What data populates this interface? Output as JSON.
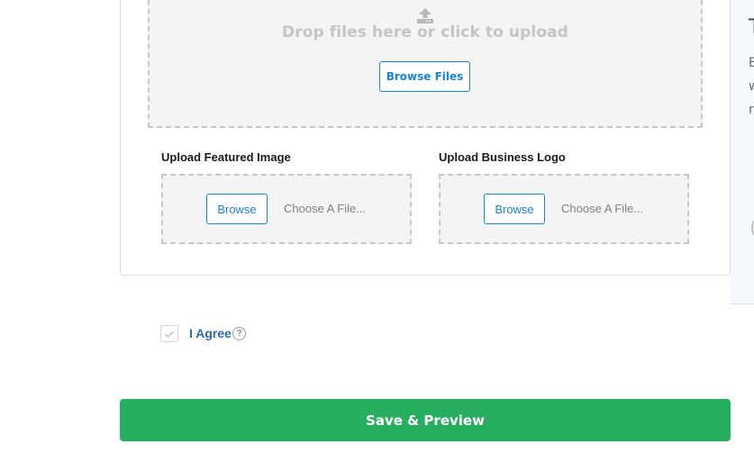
{
  "dropzone": {
    "icon": "upload-icon",
    "text": "Drop files here or click to upload",
    "browse_label": "Browse Files"
  },
  "uploads": [
    {
      "label": "Upload Featured Image",
      "browse_label": "Browse",
      "placeholder": "Choose A File..."
    },
    {
      "label": "Upload Business Logo",
      "browse_label": "Browse",
      "placeholder": "Choose A File..."
    }
  ],
  "side_panel": {
    "title": "T",
    "lines": [
      "E",
      "w",
      "r"
    ]
  },
  "agree": {
    "label": "I Agree",
    "checked": false,
    "help_icon": "?"
  },
  "save_button": {
    "label": "Save & Preview"
  },
  "colors": {
    "accent_blue": "#1a85d0",
    "agree_blue": "#2c6ea8",
    "save_green": "#27ae60",
    "dropzone_bg": "#f4f4f4",
    "dashed_border": "#c8c8c8"
  }
}
